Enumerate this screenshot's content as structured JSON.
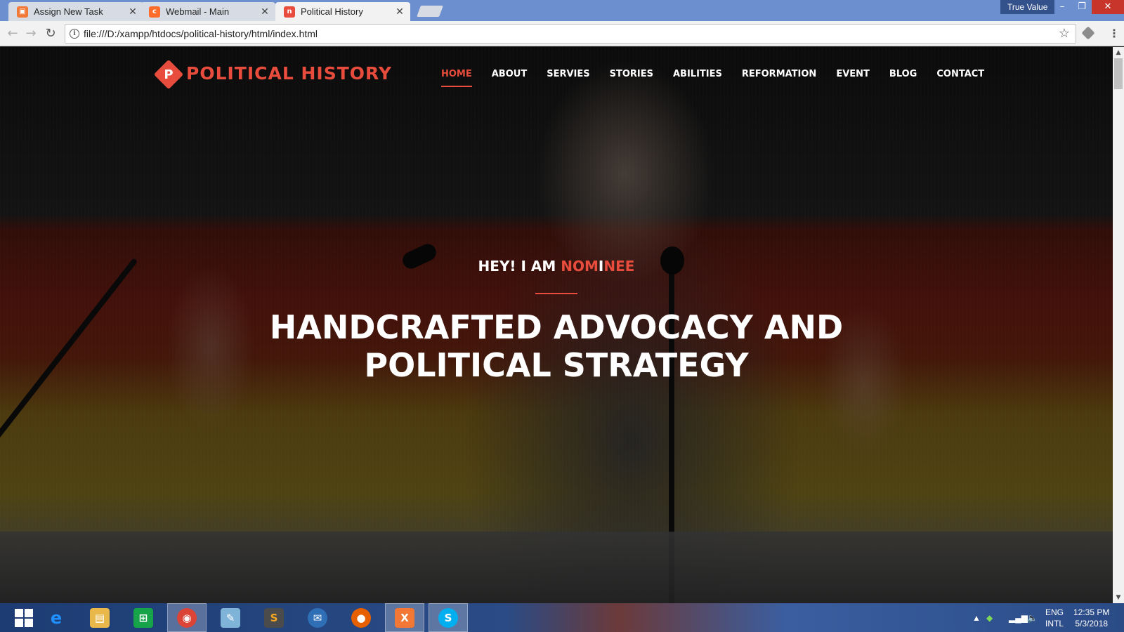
{
  "browser": {
    "tabs": [
      {
        "title": "Assign New Task",
        "favicon": "task-icon",
        "favicon_color": "#f37735"
      },
      {
        "title": "Webmail - Main",
        "favicon": "cpanel-icon",
        "favicon_color": "#ff6c2c"
      },
      {
        "title": "Political History",
        "favicon": "site-icon",
        "favicon_color": "#e74c3c"
      }
    ],
    "profile_name": "True Value",
    "url": "file:///D:/xampp/htdocs/political-history/html/index.html"
  },
  "site": {
    "logo_letter": "P",
    "logo_text": "POLITICAL HISTORY",
    "nav": [
      {
        "label": "HOME",
        "active": true
      },
      {
        "label": "ABOUT"
      },
      {
        "label": "SERVIES"
      },
      {
        "label": "STORIES"
      },
      {
        "label": "ABILITIES"
      },
      {
        "label": "REFORMATION"
      },
      {
        "label": "EVENT"
      },
      {
        "label": "BLOG"
      },
      {
        "label": "CONTACT"
      }
    ],
    "hero": {
      "pre_text": "HEY! I AM ",
      "highlight_1": "NOM",
      "highlight_2": "I",
      "highlight_3": "NEE",
      "title_line1": "HANDCRAFTED ADVOCACY AND",
      "title_line2": "POLITICAL STRATEGY"
    },
    "accent_color": "#e74c3c"
  },
  "taskbar": {
    "apps": [
      {
        "name": "internet-explorer-icon",
        "glyph": "e",
        "color": "#1e90ff"
      },
      {
        "name": "file-explorer-icon",
        "glyph": "▤",
        "color": "#e8b84a"
      },
      {
        "name": "store-icon",
        "glyph": "⊞",
        "color": "#17a34a"
      },
      {
        "name": "chrome-icon",
        "glyph": "◉",
        "color": "#db4437"
      },
      {
        "name": "notepad-icon",
        "glyph": "✎",
        "color": "#7fb3d8"
      },
      {
        "name": "sublime-text-icon",
        "glyph": "S",
        "color": "#4b4b4b"
      },
      {
        "name": "thunderbird-icon",
        "glyph": "✉",
        "color": "#2f6fb5"
      },
      {
        "name": "firefox-icon",
        "glyph": "●",
        "color": "#e66000"
      },
      {
        "name": "xampp-icon",
        "glyph": "X",
        "color": "#f37735"
      },
      {
        "name": "skype-icon",
        "glyph": "S",
        "color": "#00aff0"
      }
    ],
    "lang_line1": "ENG",
    "lang_line2": "INTL",
    "time": "12:35 PM",
    "date": "5/3/2018"
  }
}
